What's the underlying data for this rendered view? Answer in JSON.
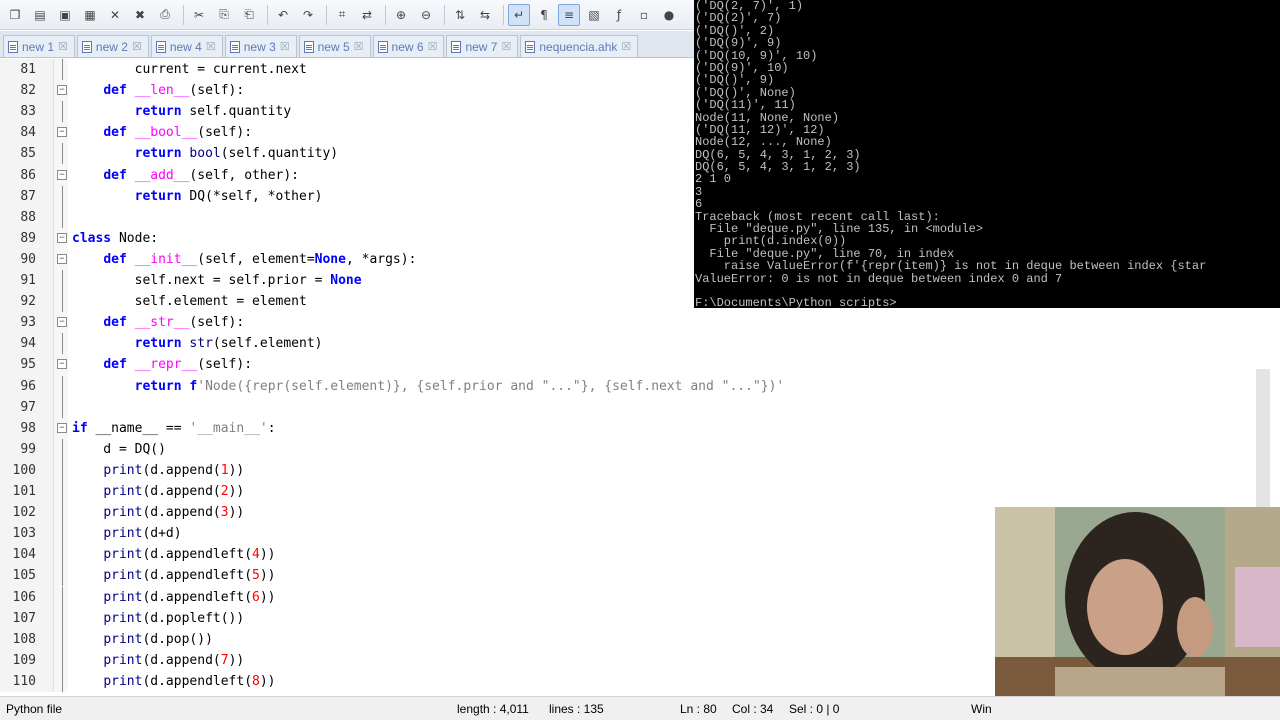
{
  "toolbar": {
    "icons": [
      "new-file-icon",
      "open-file-icon",
      "save-icon",
      "save-all-icon",
      "close-icon",
      "close-all-icon",
      "print-icon",
      "cut-icon",
      "copy-icon",
      "paste-icon",
      "undo-icon",
      "redo-icon",
      "find-icon",
      "replace-icon",
      "zoom-in-icon",
      "zoom-out-icon",
      "sync-v-icon",
      "sync-h-icon",
      "word-wrap-icon",
      "show-all-chars-icon",
      "indent-guide-icon",
      "doc-map-icon",
      "function-list-icon",
      "folder-workspace-icon",
      "macro-record-icon"
    ]
  },
  "tabs": [
    {
      "label": "new 1"
    },
    {
      "label": "new 2"
    },
    {
      "label": "new 4"
    },
    {
      "label": "new 3"
    },
    {
      "label": "new 5"
    },
    {
      "label": "new 6"
    },
    {
      "label": "new 7"
    },
    {
      "label": "nequencia.ahk"
    }
  ],
  "editor": {
    "lines": [
      {
        "num": "81",
        "code": "        current = current.next"
      },
      {
        "num": "82",
        "code": "    def __len__(self):"
      },
      {
        "num": "83",
        "code": "        return self.quantity"
      },
      {
        "num": "84",
        "code": "    def __bool__(self):"
      },
      {
        "num": "85",
        "code": "        return bool(self.quantity)"
      },
      {
        "num": "86",
        "code": "    def __add__(self, other):"
      },
      {
        "num": "87",
        "code": "        return DQ(*self, *other)"
      },
      {
        "num": "88",
        "code": ""
      },
      {
        "num": "89",
        "code": "class Node:"
      },
      {
        "num": "90",
        "code": "    def __init__(self, element=None, *args):"
      },
      {
        "num": "91",
        "code": "        self.next = self.prior = None"
      },
      {
        "num": "92",
        "code": "        self.element = element"
      },
      {
        "num": "93",
        "code": "    def __str__(self):"
      },
      {
        "num": "94",
        "code": "        return str(self.element)"
      },
      {
        "num": "95",
        "code": "    def __repr__(self):"
      },
      {
        "num": "96",
        "code": "        return f'Node({repr(self.element)}, {self.prior and \"...\"}, {self.next and \"...\"})'"
      },
      {
        "num": "97",
        "code": ""
      },
      {
        "num": "98",
        "code": "if __name__ == '__main__':"
      },
      {
        "num": "99",
        "code": "    d = DQ()"
      },
      {
        "num": "100",
        "code": "    print(d.append(1))"
      },
      {
        "num": "101",
        "code": "    print(d.append(2))"
      },
      {
        "num": "102",
        "code": "    print(d.append(3))"
      },
      {
        "num": "103",
        "code": "    print(d+d)"
      },
      {
        "num": "104",
        "code": "    print(d.appendleft(4))"
      },
      {
        "num": "105",
        "code": "    print(d.appendleft(5))"
      },
      {
        "num": "106",
        "code": "    print(d.appendleft(6))"
      },
      {
        "num": "107",
        "code": "    print(d.popleft())"
      },
      {
        "num": "108",
        "code": "    print(d.pop())"
      },
      {
        "num": "109",
        "code": "    print(d.append(7))"
      },
      {
        "num": "110",
        "code": "    print(d.appendleft(8))"
      }
    ]
  },
  "terminal": {
    "lines": [
      "('DQ(2, 7)', 1)",
      "('DQ(2)', 7)",
      "('DQ()', 2)",
      "('DQ(9)', 9)",
      "('DQ(10, 9)', 10)",
      "('DQ(9)', 10)",
      "('DQ()', 9)",
      "('DQ()', None)",
      "('DQ(11)', 11)",
      "Node(11, None, None)",
      "('DQ(11, 12)', 12)",
      "Node(12, ..., None)",
      "DQ(6, 5, 4, 3, 1, 2, 3)",
      "DQ(6, 5, 4, 3, 1, 2, 3)",
      "2 1 0",
      "3",
      "6",
      "Traceback (most recent call last):",
      "  File \"deque.py\", line 135, in <module>",
      "    print(d.index(0))",
      "  File \"deque.py\", line 70, in index",
      "    raise ValueError(f'{repr(item)} is not in deque between index {star",
      "ValueError: 0 is not in deque between index 0 and 7",
      "",
      "F:\\Documents\\Python scripts>"
    ]
  },
  "status": {
    "file_type": "Python file",
    "length": "length : 4,011",
    "lines": "lines : 135",
    "position": "Ln : 80",
    "column": "Col : 34",
    "selection": "Sel : 0 | 0",
    "eol": "Win"
  },
  "colors": {
    "keyword": "#0000ff",
    "dunder": "#ff00ff",
    "string": "#808080",
    "number": "#ff0000"
  }
}
